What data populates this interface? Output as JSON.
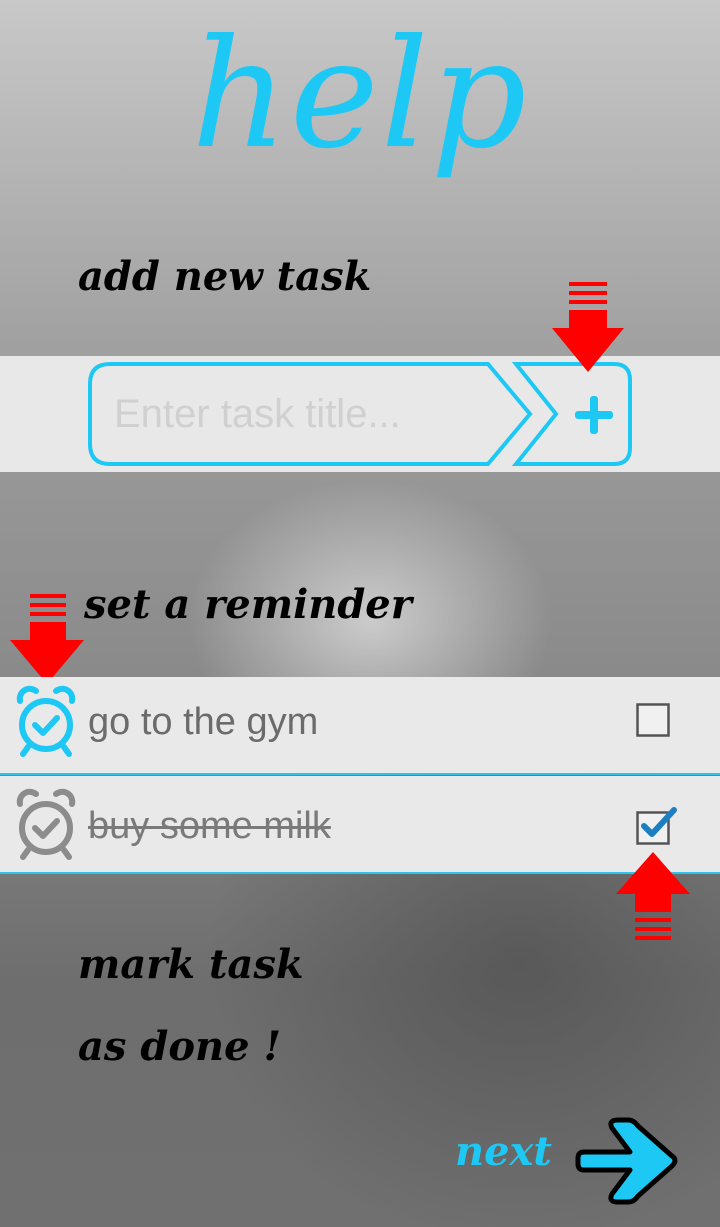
{
  "title": "help",
  "sections": {
    "add_task": "add new task",
    "reminder": "set a reminder",
    "mark_done_line1": "mark task",
    "mark_done_line2": "as done !"
  },
  "task_input": {
    "placeholder": "Enter task title..."
  },
  "tasks": [
    {
      "label": "go to the gym",
      "done": false,
      "alarm": "alarm-clock-icon",
      "alarm_color": "#1ec8f5"
    },
    {
      "label": "buy some milk",
      "done": true,
      "alarm": "alarm-clock-icon",
      "alarm_color": "#8c8c8c"
    }
  ],
  "next_label": "next",
  "colors": {
    "accent": "#1ec8f5",
    "arrow": "#ff0000",
    "panel": "#e8e8e8"
  },
  "icons": {
    "add": "plus-icon",
    "hint": "red-arrow-icon",
    "next": "arrow-right-icon",
    "check": "checkmark-icon"
  }
}
